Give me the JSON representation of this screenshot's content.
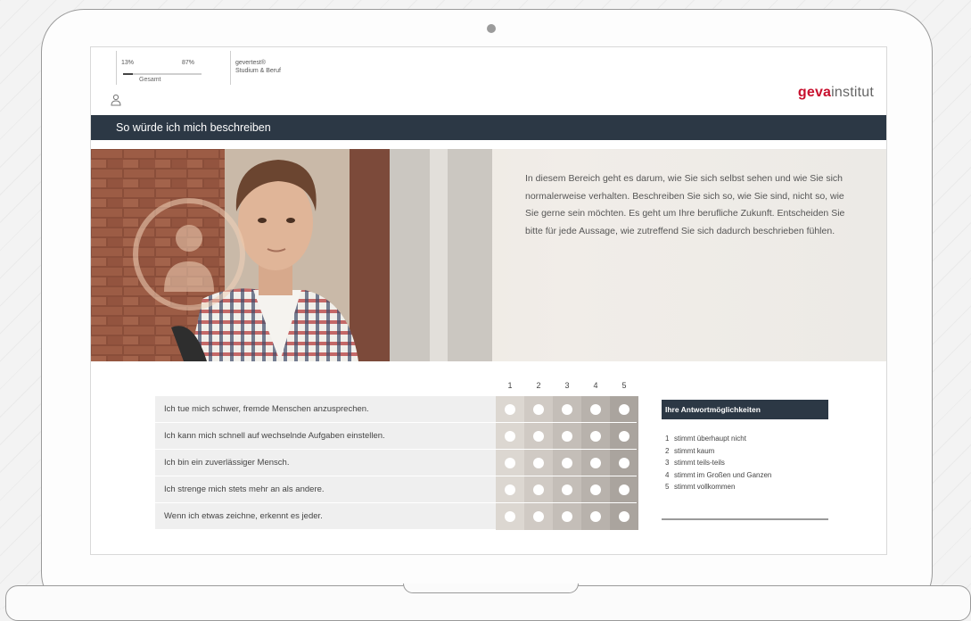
{
  "progress": {
    "left_pct": "13%",
    "right_pct": "87%",
    "label": "Gesamt",
    "fraction": 0.13
  },
  "test": {
    "line1": "gevertest®",
    "line2": "Studium & Beruf"
  },
  "brand": {
    "bold": "geva",
    "rest": "institut"
  },
  "section": {
    "title": "So würde ich mich beschreiben"
  },
  "intro": {
    "text": "In diesem Bereich geht es darum, wie Sie sich selbst sehen und wie Sie sich normalerweise verhalten. Beschreiben Sie sich so, wie Sie sind, nicht so, wie Sie gerne sein möchten. Es geht um Ihre berufliche Zukunft. Entscheiden Sie bitte für jede Aussage, wie zutreffend Sie sich dadurch beschrieben fühlen."
  },
  "scale": [
    "1",
    "2",
    "3",
    "4",
    "5"
  ],
  "items": [
    "Ich tue mich schwer, fremde Menschen anzusprechen.",
    "Ich kann mich schnell auf wechselnde Aufgaben einstellen.",
    "Ich bin ein zuverlässiger Mensch.",
    "Ich strenge mich stets mehr an als andere.",
    "Wenn ich etwas zeichne, erkennt es jeder."
  ],
  "legend": {
    "title": "Ihre Antwortmöglichkeiten",
    "options": [
      {
        "n": "1",
        "label": "stimmt überhaupt nicht"
      },
      {
        "n": "2",
        "label": "stimmt kaum"
      },
      {
        "n": "3",
        "label": "stimmt teils-teils"
      },
      {
        "n": "4",
        "label": "stimmt im Großen und Ganzen"
      },
      {
        "n": "5",
        "label": "stimmt vollkommen"
      }
    ]
  },
  "colors": {
    "navy": "#2c3845",
    "brand_red": "#c8102e",
    "col_shades": [
      "#dcd7d1",
      "#d0cac4",
      "#c4beb8",
      "#b8b2ac",
      "#aaa49e"
    ]
  },
  "icons": {
    "user": "user-icon",
    "laptop_camera": "camera-icon",
    "hero_badge": "person-badge-icon"
  }
}
